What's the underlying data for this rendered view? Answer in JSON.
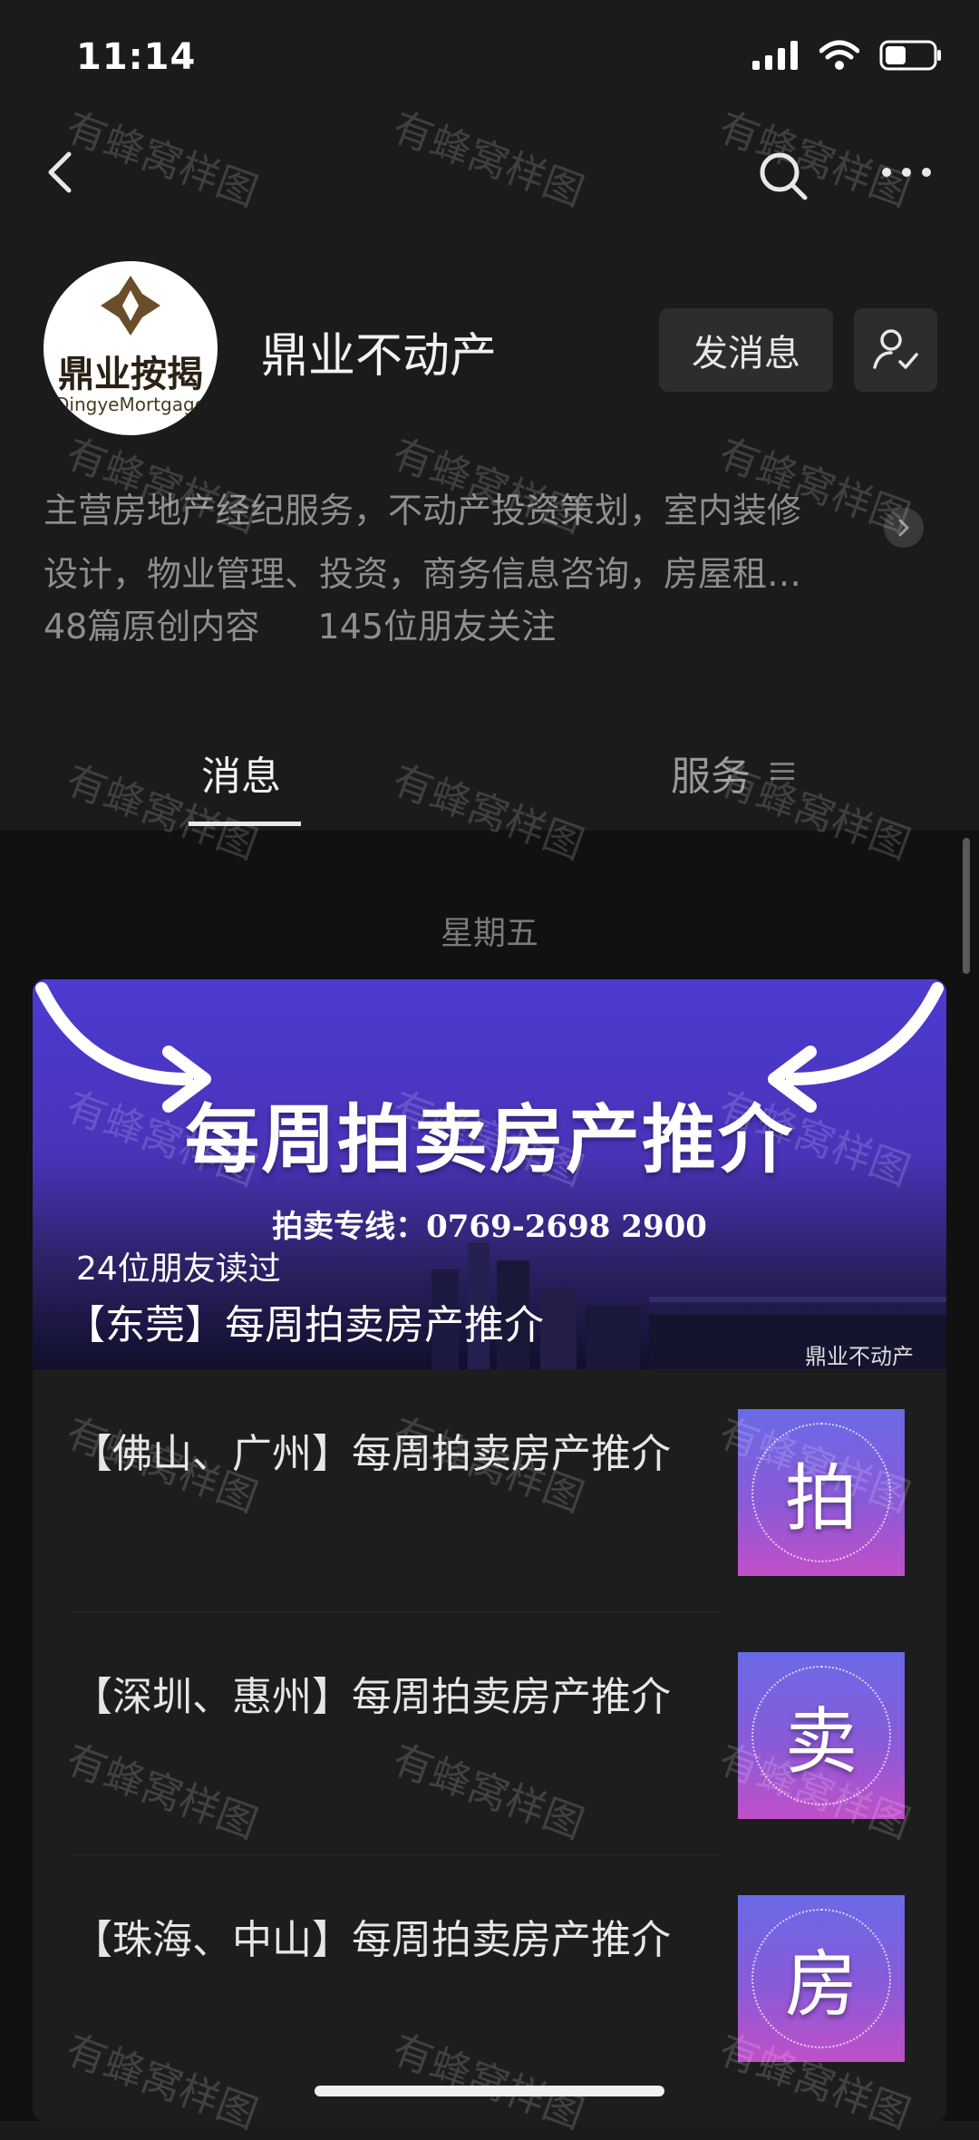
{
  "status_bar": {
    "time": "11:14"
  },
  "profile": {
    "avatar_cn": "鼎业按揭",
    "avatar_en": "DingyeMortgage",
    "name": "鼎业不动产",
    "message_button": "发消息",
    "intro_line1": "主营房地产经纪服务，不动产投资策划，室内装修",
    "intro_line2": "设计，物业管理、投资，商务信息咨询，房屋租…",
    "stats_original": "48篇原创内容",
    "stats_followers": "145位朋友关注"
  },
  "tabs": [
    {
      "label": "消息",
      "active": true
    },
    {
      "label": "服务",
      "active": false
    }
  ],
  "feed": {
    "date": "星期五",
    "banner": {
      "title": "每周拍卖房产推介",
      "phone": "拍卖专线：0769-2698 2900",
      "readers": "24位朋友读过",
      "headline": "【东莞】每周拍卖房产推介",
      "source_watermark": "鼎业不动产"
    },
    "items": [
      {
        "title": "【佛山、广州】每周拍卖房产推介",
        "thumb_char": "拍"
      },
      {
        "title": "【深圳、惠州】每周拍卖房产推介",
        "thumb_char": "卖"
      },
      {
        "title": "【珠海、中山】每周拍卖房产推介",
        "thumb_char": "房"
      }
    ]
  },
  "watermark_text": "有蜂窝样图",
  "colors": {
    "background": "#1b1b1b",
    "content_background": "#111111",
    "banner_purple": "#4c3bd1",
    "thumb_gradient_top": "#6a6ae6",
    "thumb_gradient_bottom": "#c050c8"
  },
  "icons": [
    "back-icon",
    "search-icon",
    "more-icon",
    "follow-icon",
    "signal-icon",
    "wifi-icon",
    "battery-icon",
    "chevron-right-icon",
    "menu-icon"
  ]
}
